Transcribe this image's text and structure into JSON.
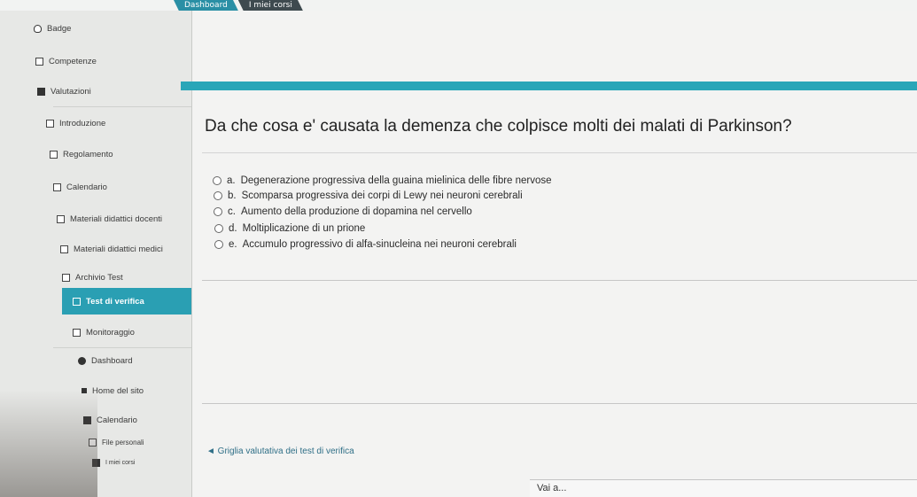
{
  "topnav": {
    "tabs": [
      {
        "label": "Dashboard"
      },
      {
        "label": "I miei corsi"
      }
    ]
  },
  "sidebar": {
    "items": [
      {
        "label": "Badge",
        "icon": "badge-icon"
      },
      {
        "label": "Competenze",
        "icon": "checkbox-icon"
      },
      {
        "label": "Valutazioni",
        "icon": "table-icon"
      },
      {
        "label": "Introduzione",
        "icon": "folder-icon"
      },
      {
        "label": "Regolamento",
        "icon": "folder-icon"
      },
      {
        "label": "Calendario",
        "icon": "folder-icon"
      },
      {
        "label": "Materiali didattici docenti",
        "icon": "folder-icon"
      },
      {
        "label": "Materiali didattici medici",
        "icon": "folder-icon"
      },
      {
        "label": "Archivio Test",
        "icon": "folder-icon"
      },
      {
        "label": "Test di verifica",
        "icon": "folder-icon",
        "active": true
      },
      {
        "label": "Monitoraggio",
        "icon": "folder-icon"
      },
      {
        "label": "Dashboard",
        "icon": "dashboard-icon"
      },
      {
        "label": "Home del sito",
        "icon": "home-icon"
      },
      {
        "label": "Calendario",
        "icon": "calendar-icon"
      },
      {
        "label": "File personali",
        "icon": "file-icon"
      },
      {
        "label": "I miei corsi",
        "icon": "courses-icon"
      }
    ]
  },
  "question": {
    "text": "Da che cosa e' causata la demenza che colpisce molti dei malati di Parkinson?",
    "options": [
      {
        "letter": "a.",
        "text": "Degenerazione progressiva della guaina mielinica delle fibre nervose"
      },
      {
        "letter": "b.",
        "text": "Scomparsa progressiva dei corpi di Lewy nei neuroni cerebrali"
      },
      {
        "letter": "c.",
        "text": "Aumento della produzione di dopamina nel cervello"
      },
      {
        "letter": "d.",
        "text": "Moltiplicazione di un prione"
      },
      {
        "letter": "e.",
        "text": "Accumulo progressivo di alfa-sinucleina nei neuroni cerebrali"
      }
    ]
  },
  "footer": {
    "back_link": "◄ Griglia valutativa dei test di verifica",
    "goto_label": "Vai a..."
  },
  "colors": {
    "accent": "#2aa6b8",
    "active_item": "#2a9fb3"
  }
}
